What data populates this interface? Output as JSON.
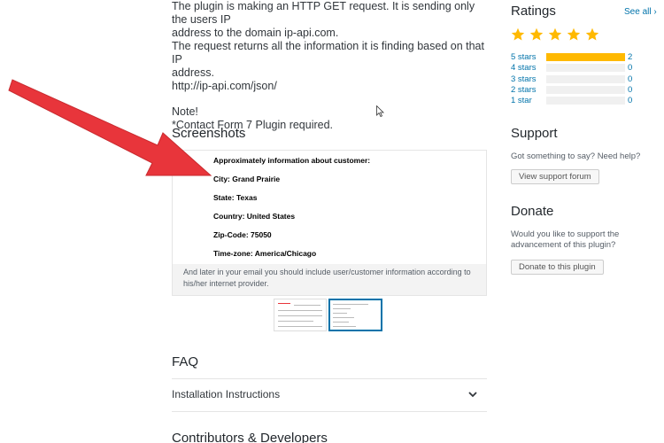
{
  "description": {
    "lines": [
      "The plugin is making an HTTP GET request. It is sending only the users IP",
      "address to the domain ip-api.com.",
      "The request returns all the information it is finding based on that IP",
      "address.",
      "http://ip-api.com/json/"
    ],
    "note_lines": [
      "Note!",
      "*Contact Form 7 Plugin required."
    ]
  },
  "screenshots": {
    "heading": "Screenshots",
    "image_lines": [
      "Approximately information about customer:",
      "City: Grand Prairie",
      "State: Texas",
      "Country: United States",
      "Zip-Code: 75050",
      "Time-zone: America/Chicago"
    ],
    "caption": "And later in your email you should include user/customer information according to his/her internet provider."
  },
  "faq": {
    "heading": "FAQ",
    "items": [
      "Installation Instructions"
    ]
  },
  "contributors": {
    "heading": "Contributors & Developers"
  },
  "sidebar": {
    "ratings": {
      "heading": "Ratings",
      "see_all": "See all",
      "average_stars": 5,
      "rows": [
        {
          "label": "5 stars",
          "count": "2",
          "fraction": 1.0
        },
        {
          "label": "4 stars",
          "count": "0",
          "fraction": 0
        },
        {
          "label": "3 stars",
          "count": "0",
          "fraction": 0
        },
        {
          "label": "2 stars",
          "count": "0",
          "fraction": 0
        },
        {
          "label": "1 star",
          "count": "0",
          "fraction": 0
        }
      ]
    },
    "support": {
      "heading": "Support",
      "text": "Got something to say? Need help?",
      "button": "View support forum"
    },
    "donate": {
      "heading": "Donate",
      "text_line1": "Would you like to support the",
      "text_line2": "advancement of this plugin?",
      "button": "Donate to this plugin"
    }
  },
  "colors": {
    "accent": "#0073aa",
    "star": "#ffb900",
    "annotation_arrow": "#e8353b"
  }
}
